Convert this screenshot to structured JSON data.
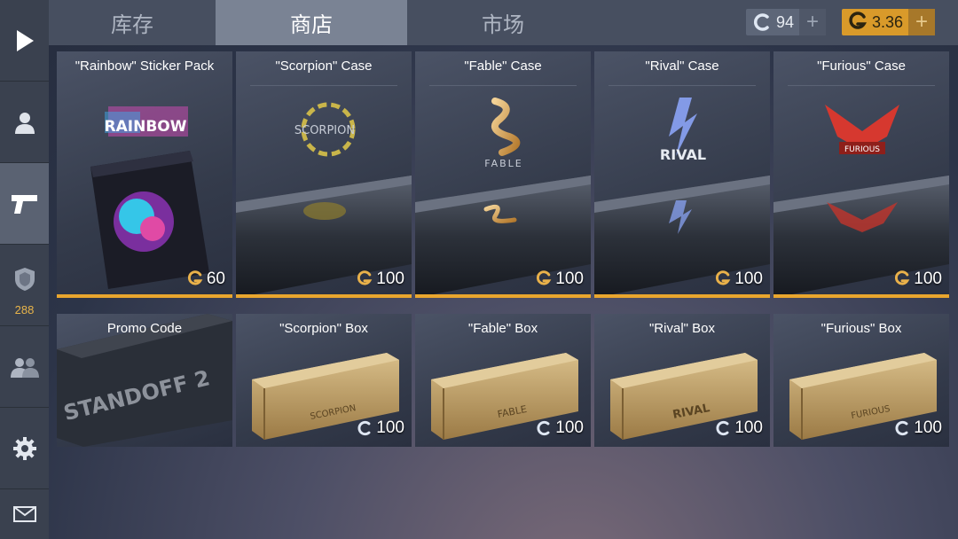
{
  "tabs": [
    {
      "label": "库存",
      "active": false
    },
    {
      "label": "商店",
      "active": true
    },
    {
      "label": "市场",
      "active": false
    }
  ],
  "currency": {
    "credits": "94",
    "gold": "3.36",
    "plus": "+"
  },
  "sidebar": {
    "rank_value": "288"
  },
  "colors": {
    "gold_accent": "#e9a62e",
    "tab_active": "#7a8394",
    "sidebar": "#3a414f"
  },
  "cards": [
    {
      "title": "\"Rainbow\" Sticker Pack",
      "price": "60",
      "currency": "gold",
      "art_text": "RAINBOW"
    },
    {
      "title": "\"Scorpion\" Case",
      "price": "100",
      "currency": "gold",
      "art_text": "SCORPION"
    },
    {
      "title": "\"Fable\" Case",
      "price": "100",
      "currency": "gold",
      "art_text": "FABLE"
    },
    {
      "title": "\"Rival\" Case",
      "price": "100",
      "currency": "gold",
      "art_text": "RIVAL"
    },
    {
      "title": "\"Furious\" Case",
      "price": "100",
      "currency": "gold",
      "art_text": "FURIOUS"
    },
    {
      "title": "Promo Code",
      "price": "",
      "currency": "",
      "art_text": "STANDOFF 2"
    },
    {
      "title": "\"Scorpion\" Box",
      "price": "100",
      "currency": "credits",
      "art_text": "SCORPION"
    },
    {
      "title": "\"Fable\" Box",
      "price": "100",
      "currency": "credits",
      "art_text": "FABLE"
    },
    {
      "title": "\"Rival\" Box",
      "price": "100",
      "currency": "credits",
      "art_text": "RIVAL"
    },
    {
      "title": "\"Furious\" Box",
      "price": "100",
      "currency": "credits",
      "art_text": "FURIOUS"
    }
  ]
}
